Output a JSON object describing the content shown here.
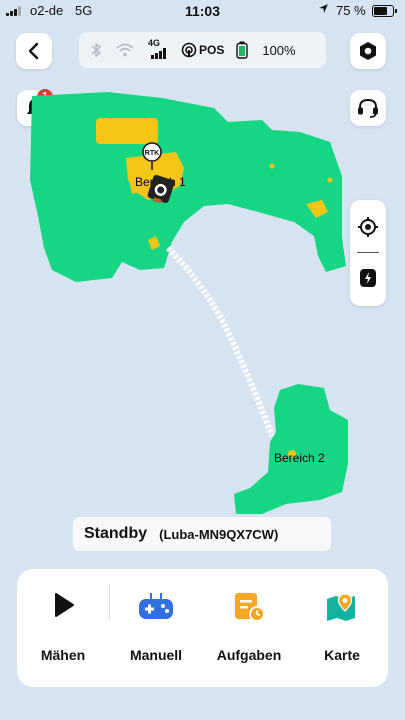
{
  "status_bar": {
    "carrier": "o2-de",
    "network": "5G",
    "time": "11:03",
    "battery_percent": "75 %",
    "battery_level": 0.75
  },
  "top": {
    "back_icon": "chevron-left-icon",
    "settings_icon": "hexagon-settings-icon",
    "connection": {
      "cellular_label": "4G",
      "pos_label": "POS",
      "device_battery": "100%"
    }
  },
  "notifications": {
    "count": "1"
  },
  "support_icon": "headset-icon",
  "side_controls": {
    "locate_icon": "crosshair-icon",
    "mower_icon": "mower-icon"
  },
  "map": {
    "zones": [
      {
        "label": "Bereich 1"
      },
      {
        "label": "Bereich 2"
      }
    ],
    "rtk_label": "RTK",
    "colors": {
      "lawn": "#16d684",
      "obstacle": "#f5c518",
      "path": "#ffffff",
      "background": "#d6e4f2"
    }
  },
  "device_status": {
    "state": "Standby",
    "device_id": "(Luba-MN9QX7CW)"
  },
  "actions": [
    {
      "label": "Mähen",
      "icon": "play-icon"
    },
    {
      "label": "Manuell",
      "icon": "gamepad-icon"
    },
    {
      "label": "Aufgaben",
      "icon": "tasks-icon"
    },
    {
      "label": "Karte",
      "icon": "map-pin-icon"
    }
  ]
}
